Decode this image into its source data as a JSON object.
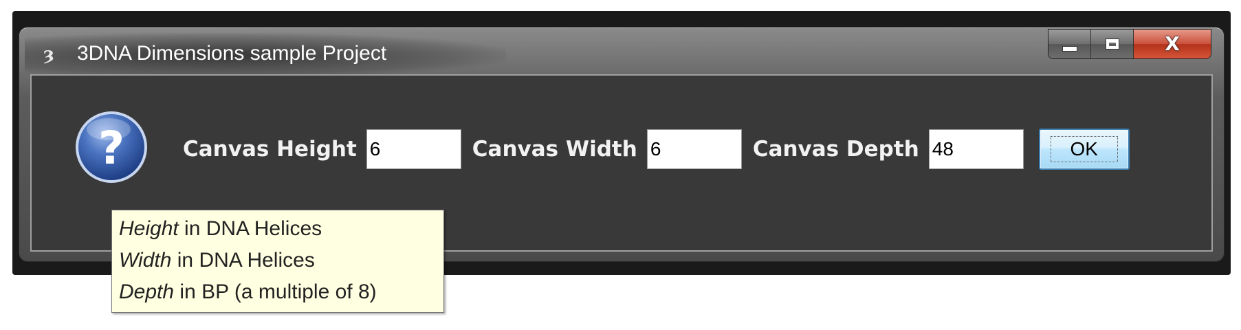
{
  "window": {
    "title": "3DNA Dimensions sample Project",
    "app_icon": "3dna-app-icon",
    "caption_buttons": {
      "minimize": "minimize-icon",
      "maximize": "maximize-icon",
      "close": "close-icon",
      "close_glyph": "X"
    }
  },
  "dialog": {
    "icon": "question-icon",
    "fields": [
      {
        "label": "Canvas Height",
        "value": "6"
      },
      {
        "label": "Canvas Width",
        "value": "6"
      },
      {
        "label": "Canvas Depth",
        "value": "48"
      }
    ],
    "ok_label": "OK"
  },
  "tooltip": {
    "lines": [
      {
        "emphasis": "Height",
        "rest": " in DNA Helices"
      },
      {
        "emphasis": "Width",
        "rest": " in DNA Helices"
      },
      {
        "emphasis": "Depth",
        "rest": " in BP (a multiple of 8)"
      }
    ]
  },
  "colors": {
    "client_background": "#393939",
    "tooltip_background": "#ffffe1",
    "close_button": "#c9503b",
    "ok_button_border": "#3c7fb1",
    "question_icon_blue": "#3a63b0"
  }
}
